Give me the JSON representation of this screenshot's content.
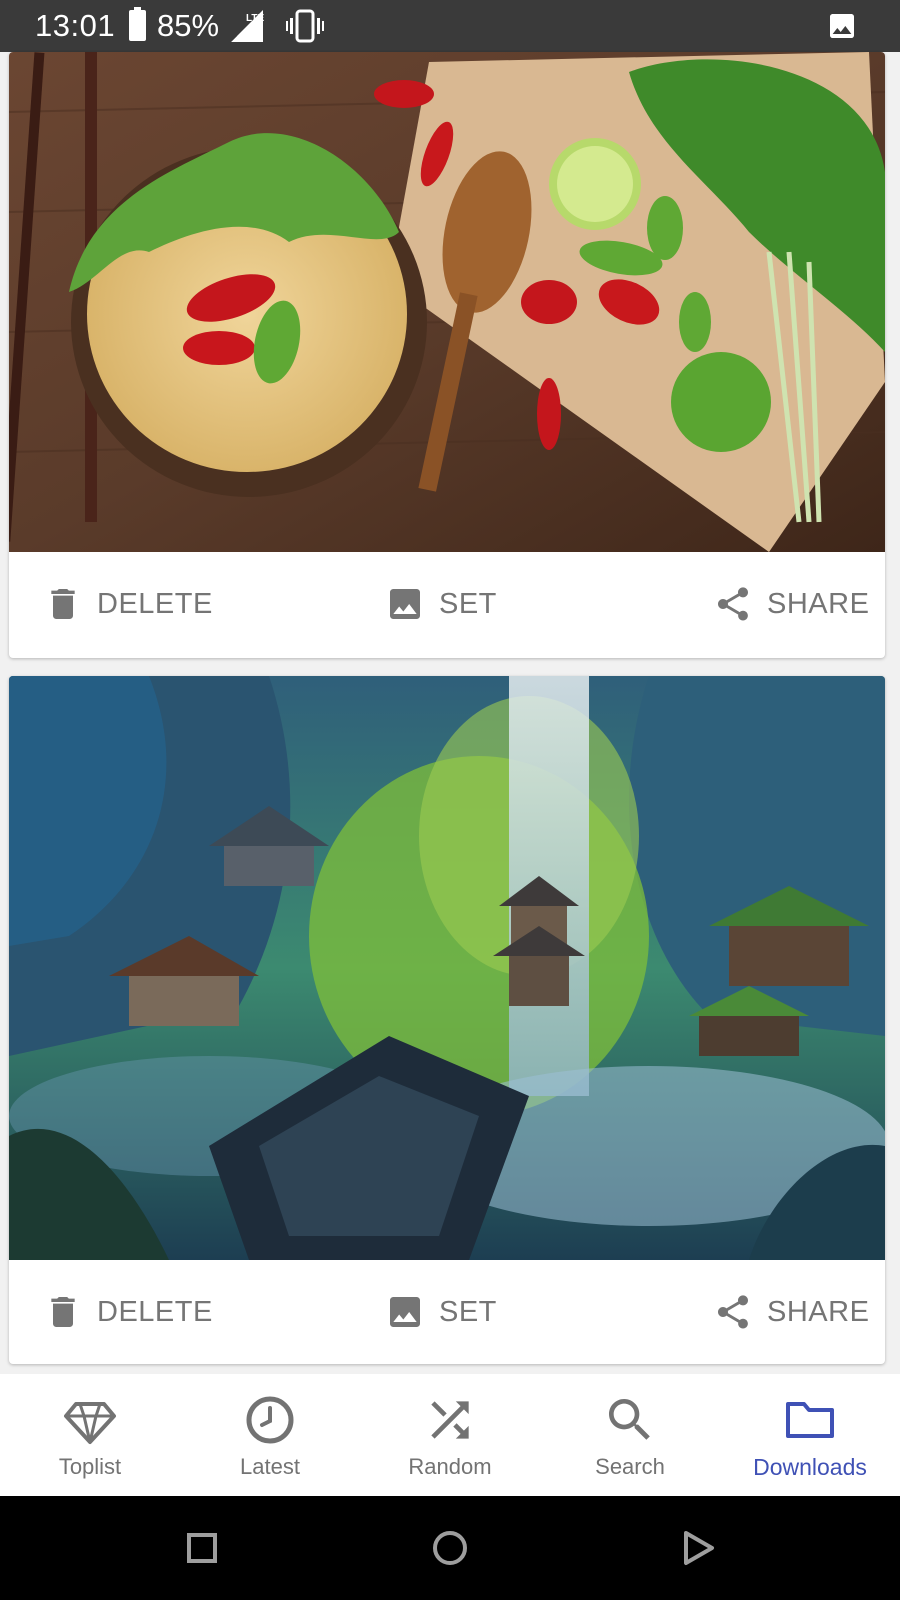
{
  "status_bar": {
    "time": "13:01",
    "battery": "85%",
    "network": "LTE"
  },
  "cards": [
    {
      "image_label": "noodle-bowl-with-chilies-wallpaper",
      "actions": {
        "delete": "DELETE",
        "set": "SET",
        "share": "SHARE"
      }
    },
    {
      "image_label": "fantasy-waterfall-village-wallpaper",
      "actions": {
        "delete": "DELETE",
        "set": "SET",
        "share": "SHARE"
      }
    }
  ],
  "bottom_nav": {
    "items": [
      {
        "label": "Toplist",
        "icon": "diamond-icon",
        "active": false
      },
      {
        "label": "Latest",
        "icon": "clock-icon",
        "active": false
      },
      {
        "label": "Random",
        "icon": "shuffle-icon",
        "active": false
      },
      {
        "label": "Search",
        "icon": "search-icon",
        "active": false
      },
      {
        "label": "Downloads",
        "icon": "folder-icon",
        "active": true
      }
    ]
  },
  "colors": {
    "accent": "#3f51b5",
    "inactive": "#737373",
    "action_text": "#757575",
    "status_bar": "#3a3a3a"
  }
}
